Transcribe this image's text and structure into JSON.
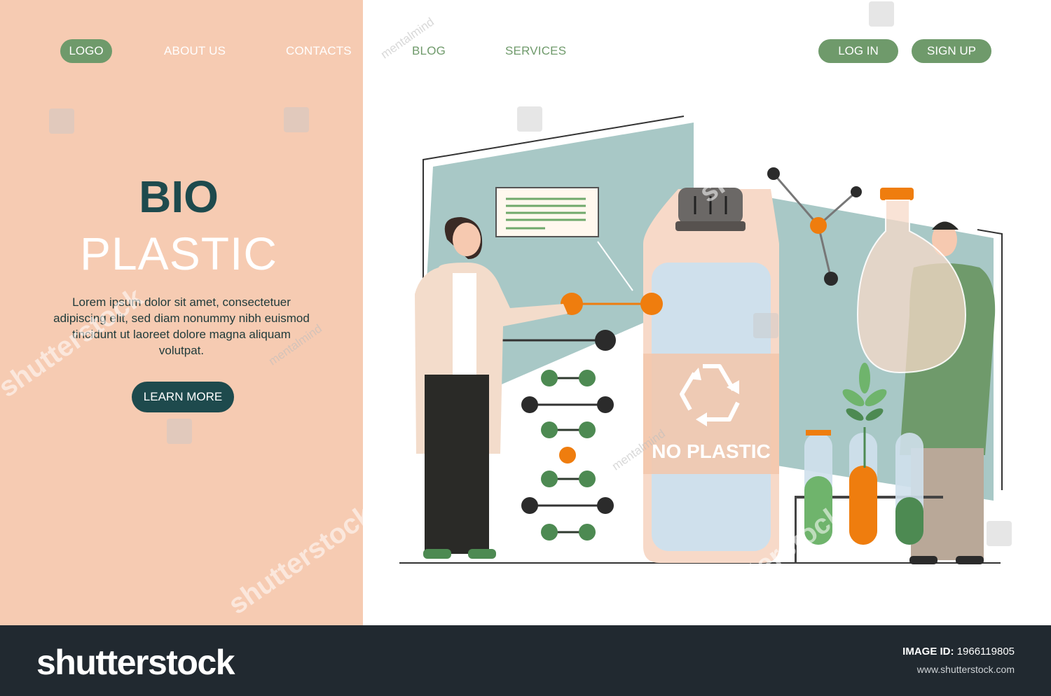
{
  "nav": {
    "logo": "LOGO",
    "about": "ABOUT US",
    "contacts": "CONTACTS",
    "blog": "BLOG",
    "services": "SERVICES",
    "login": "LOG IN",
    "signup": "SIGN UP"
  },
  "hero": {
    "title_line1": "BIO",
    "title_line2": "PLASTIC",
    "description": "Lorem ipsum dolor sit amet, consectetuer adipiscing elit, sed diam nonummy nibh euismod tincidunt ut laoreet dolore magna aliquam volutpat.",
    "cta": "LEARN MORE"
  },
  "illustration": {
    "bottle_label": "NO PLASTIC",
    "icons": [
      "recycle-icon",
      "molecule-icon",
      "flask-icon",
      "test-tube-icon",
      "plant-icon"
    ]
  },
  "watermark": {
    "text": "shutterstock",
    "author": "mentalmind"
  },
  "footer": {
    "brand": "shutterstock",
    "image_id_label": "IMAGE ID:",
    "image_id": "1966119805",
    "site": "www.shutterstock.com"
  },
  "colors": {
    "peach": "#f6cbb2",
    "green": "#6f9a6b",
    "teal_dark": "#1e4a4d",
    "orange": "#ef7d0e",
    "footer": "#212930"
  }
}
